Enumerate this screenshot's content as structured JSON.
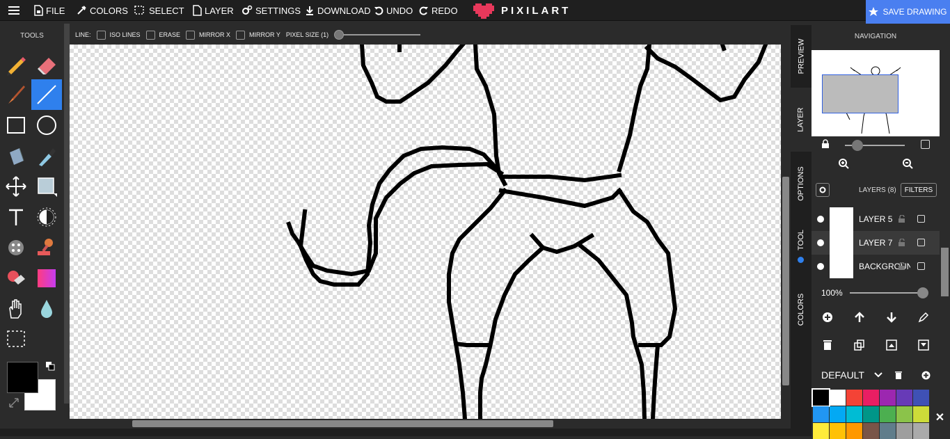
{
  "topbar": {
    "file": "FILE",
    "colors": "COLORS",
    "select": "SELECT",
    "layer": "LAYER",
    "settings": "SETTINGS",
    "download": "DOWNLOAD",
    "undo": "UNDO",
    "redo": "REDO",
    "logo": "PIXILART",
    "save": "SAVE DRAWING",
    "save_color": "#4a7ff0"
  },
  "tools": {
    "title": "TOOLS",
    "active": "line",
    "accent": "#2f80ed",
    "primary_color": "#000000",
    "secondary_color": "#ffffff"
  },
  "options": {
    "line_label": "LINE:",
    "iso_lines": "ISO LINES",
    "erase": "ERASE",
    "mirror_x": "MIRROR X",
    "mirror_y": "MIRROR Y",
    "pixel_size": "PIXEL SIZE (1)"
  },
  "sidetabs": {
    "preview": "PREVIEW",
    "layer": "LAYER",
    "options": "OPTIONS",
    "tool": "TOOL",
    "colors": "COLORS"
  },
  "navigation": {
    "title": "NAVIGATION"
  },
  "layers": {
    "title": "LAYERS (8)",
    "filters": "FILTERS",
    "items": [
      {
        "name": "LAYER 5"
      },
      {
        "name": "LAYER 7"
      },
      {
        "name": "BACKGROUND"
      }
    ],
    "opacity": "100%"
  },
  "palette": {
    "name": "DEFAULT",
    "colors": [
      "#000000",
      "#ffffff",
      "#f44336",
      "#e91e63",
      "#9c27b0",
      "#673ab7",
      "#3f51b5",
      "#2196f3",
      "#03a9f4",
      "#00bcd4",
      "#009688",
      "#4caf50",
      "#8bc34a",
      "#cddc39",
      "#ffeb3b",
      "#ffc107",
      "#ff9800",
      "#795548",
      "#607d8b",
      "#9e9e9e",
      "#aaaaaa"
    ]
  }
}
